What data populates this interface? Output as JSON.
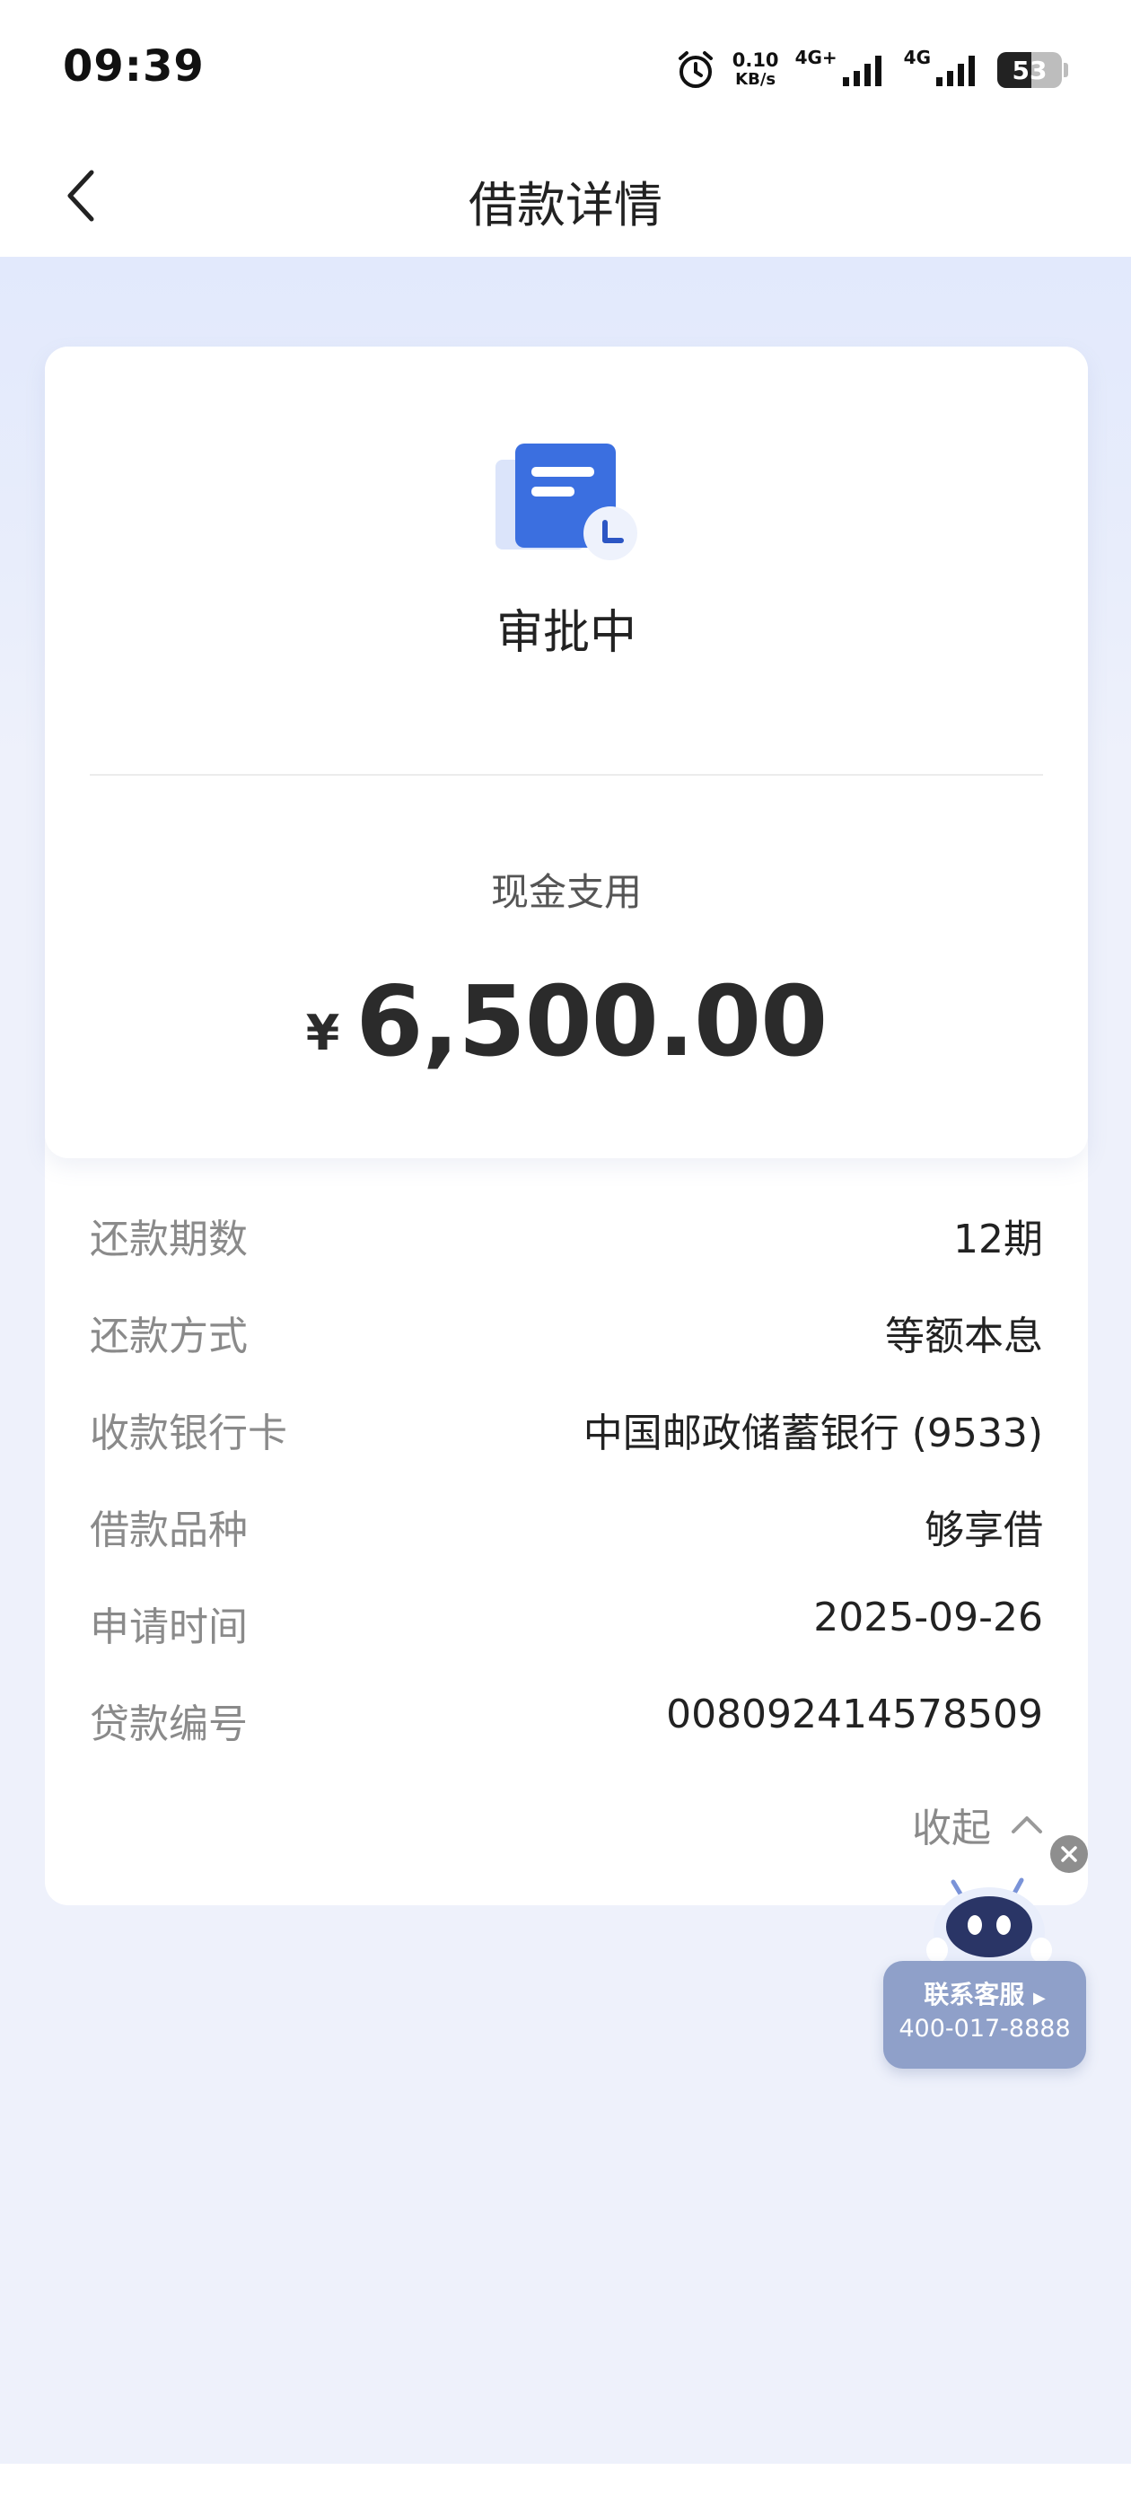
{
  "status_bar": {
    "time": "09:39",
    "net_speed_value": "0.10",
    "net_speed_unit": "KB/s",
    "signal1_label": "4G+",
    "signal2_label": "4G",
    "battery_percent": "53",
    "battery_level": 0.53,
    "icons": [
      "alarm-icon",
      "signal-icon",
      "signal-icon",
      "battery-icon"
    ]
  },
  "nav": {
    "title": "借款详情",
    "back_icon": "chevron-left-icon"
  },
  "card": {
    "status": "审批中",
    "status_icon": "document-clock-icon",
    "purpose": "现金支用",
    "currency": "¥",
    "amount": "6,500.00"
  },
  "details": [
    {
      "label": "还款期数",
      "value": "12期"
    },
    {
      "label": "还款方式",
      "value": "等额本息"
    },
    {
      "label": "收款银行卡",
      "value": "中国邮政储蓄银行 (9533)"
    },
    {
      "label": "借款品种",
      "value": "够享借"
    },
    {
      "label": "申请时间",
      "value": "2025-09-26"
    },
    {
      "label": "贷款编号",
      "value": "008092414578509"
    }
  ],
  "collapse_label": "收起",
  "customer_service": {
    "title": "联系客服",
    "phone": "400-017-8888"
  },
  "colors": {
    "accent_blue": "#3b6fe0",
    "header_bg": "#e2e9fc",
    "page_bg": "#eef1fb",
    "widget_bg": "#8fa0c9"
  }
}
